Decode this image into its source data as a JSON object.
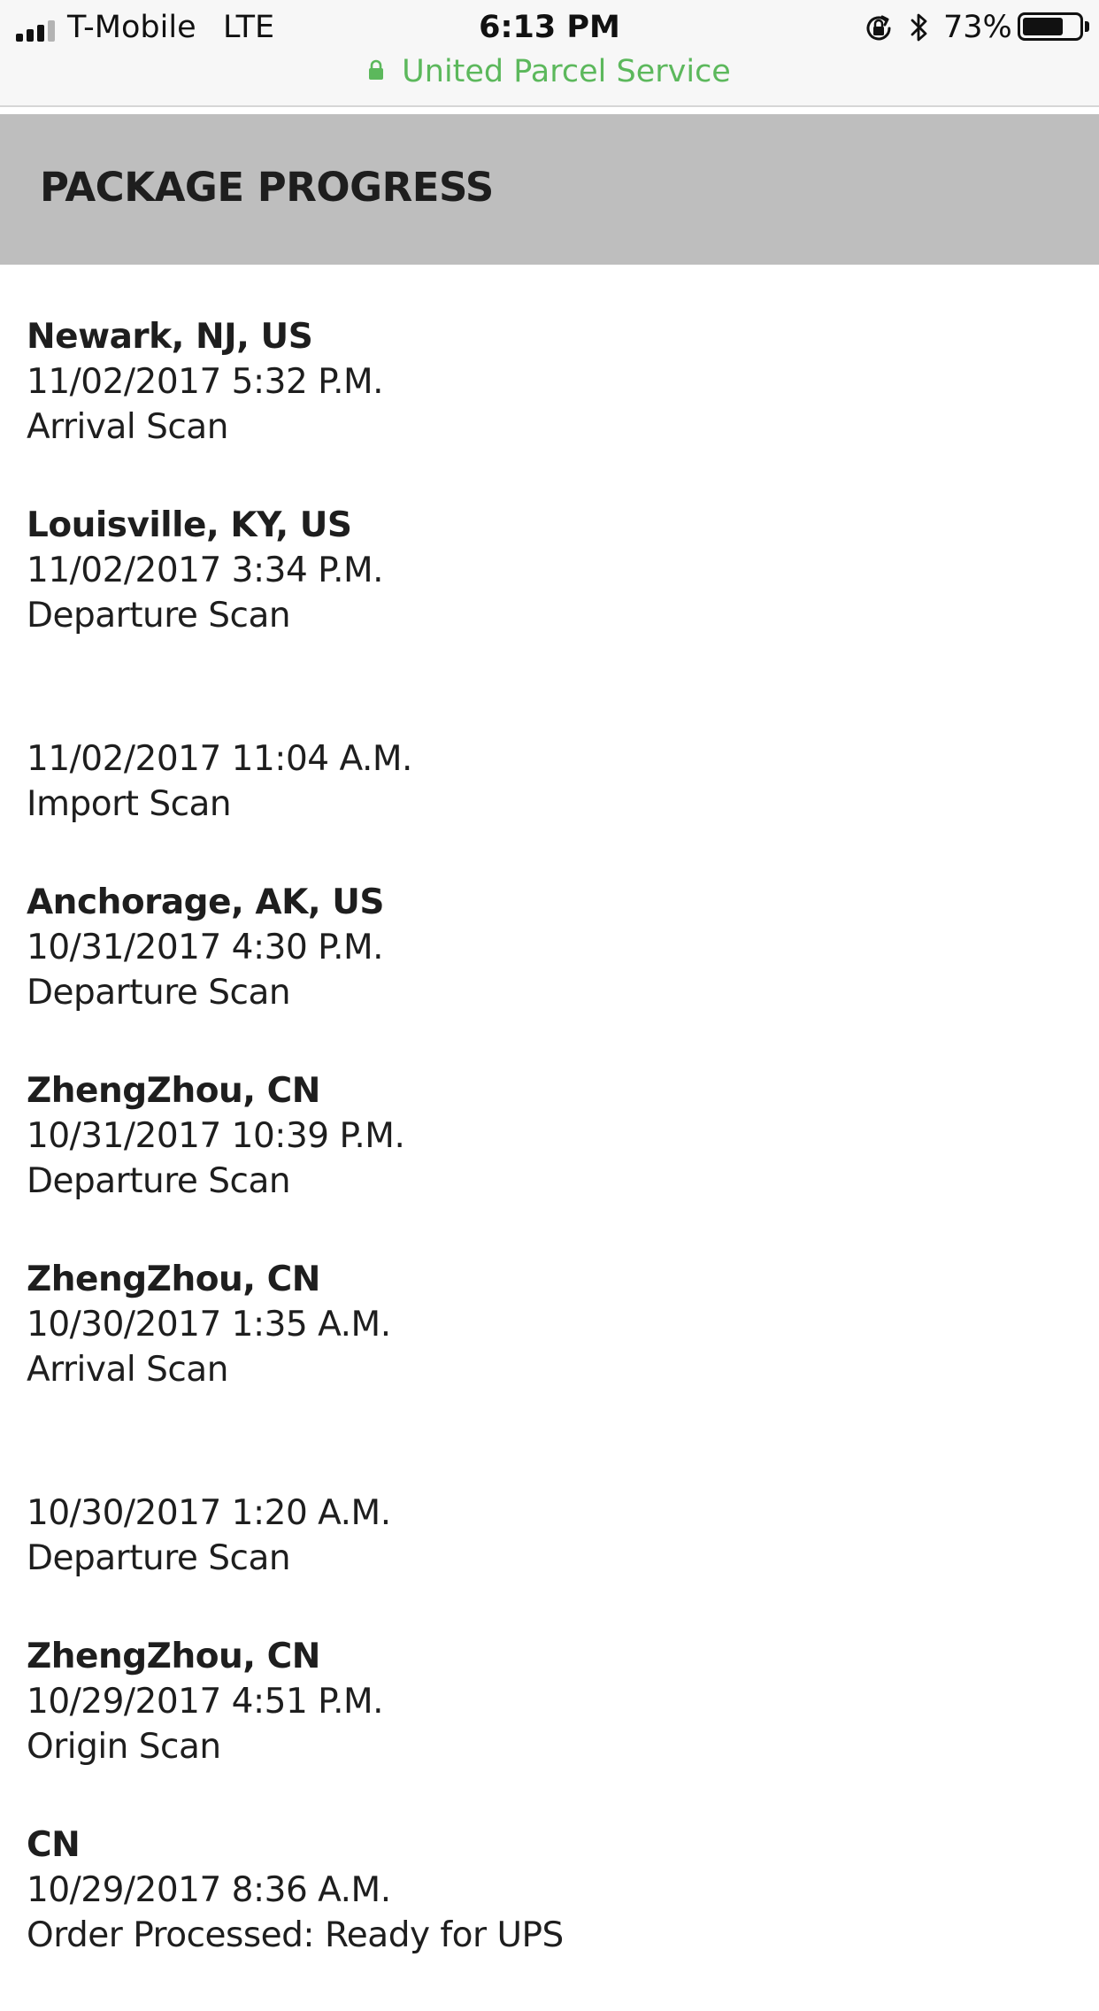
{
  "status_bar": {
    "carrier": "T-Mobile",
    "network": "LTE",
    "time": "6:13 PM",
    "battery_percent": "73%",
    "battery_level": 0.73,
    "signal_bars_filled": 3,
    "signal_bars_total": 4,
    "icons": [
      "signal-icon",
      "orientation-lock-icon",
      "bluetooth-icon",
      "battery-icon"
    ]
  },
  "address_bar": {
    "site_name": "United Parcel Service",
    "secure": true,
    "accent_color": "#5cb85c"
  },
  "section": {
    "title": "PACKAGE PROGRESS",
    "header_color": "#bebebe"
  },
  "events": [
    {
      "location": "Newark, NJ, US",
      "datetime": "11/02/2017 5:32 P.M.",
      "activity": "Arrival Scan"
    },
    {
      "location": "Louisville, KY, US",
      "datetime": "11/02/2017 3:34 P.M.",
      "activity": "Departure Scan"
    },
    {
      "location": "",
      "datetime": "11/02/2017 11:04 A.M.",
      "activity": "Import Scan"
    },
    {
      "location": "Anchorage, AK, US",
      "datetime": "10/31/2017 4:30 P.M.",
      "activity": "Departure Scan"
    },
    {
      "location": "ZhengZhou, CN",
      "datetime": "10/31/2017 10:39 P.M.",
      "activity": "Departure Scan"
    },
    {
      "location": "ZhengZhou, CN",
      "datetime": "10/30/2017 1:35 A.M.",
      "activity": "Arrival Scan"
    },
    {
      "location": "",
      "datetime": "10/30/2017 1:20 A.M.",
      "activity": "Departure Scan"
    },
    {
      "location": "ZhengZhou, CN",
      "datetime": "10/29/2017 4:51 P.M.",
      "activity": "Origin Scan"
    },
    {
      "location": "CN",
      "datetime": "10/29/2017 8:36 A.M.",
      "activity": "Order Processed: Ready for UPS"
    }
  ]
}
